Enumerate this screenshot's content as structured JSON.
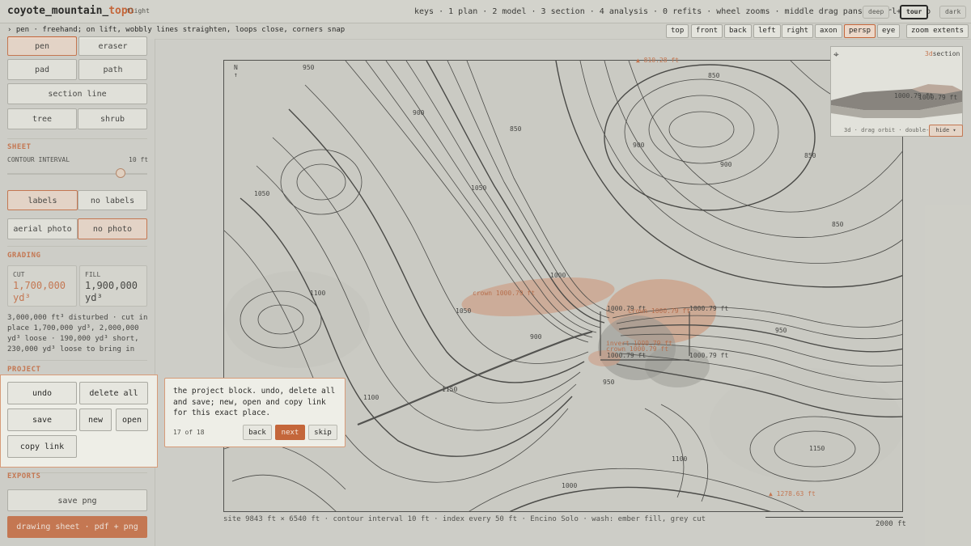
{
  "app": {
    "title_main": "coyote_mountain_",
    "title_accent": "topo",
    "mode": "flight",
    "keys_hint": "keys · 1 plan · 2 model · 3 section · 4 analysis · 0 refits · wheel zooms · middle drag pans · ctrl+z undo",
    "theme_buttons": [
      "deep",
      "tour",
      "dark"
    ]
  },
  "hintbar": {
    "text": "› pen · freehand; on lift, wobbly lines straighten, loops close, corners snap",
    "views": [
      "top",
      "front",
      "back",
      "left",
      "right",
      "axon",
      "persp",
      "eye"
    ],
    "active_view": "persp",
    "zoom_extents": "zoom extents"
  },
  "sidebar": {
    "tools": [
      "pen",
      "eraser",
      "pad",
      "path",
      "section line",
      "tree",
      "shrub"
    ],
    "sheet_title": "SHEET",
    "contour_interval_label": "CONTOUR INTERVAL",
    "contour_interval_value": "10 ft",
    "contour_interval_slider": 0.8,
    "labels_toggle": [
      "labels",
      "no labels"
    ],
    "photo_toggle": [
      "aerial photo",
      "no photo"
    ],
    "grading_title": "GRADING",
    "cut_label": "CUT",
    "cut_value": "1,700,000",
    "cut_unit": "yd³",
    "fill_label": "FILL",
    "fill_value": "1,900,000",
    "fill_unit": "yd³",
    "summary": "3,000,000 ft³ disturbed · cut in place 1,700,000 yd³, 2,000,000 yd³ loose · 190,000 yd³ short, 230,000 yd³ loose to bring in",
    "project_title": "PROJECT",
    "project_buttons": {
      "undo": "undo",
      "delete_all": "delete all",
      "save": "save",
      "new": "new",
      "open": "open",
      "copy_link": "copy link"
    },
    "exports_title": "EXPORTS",
    "save_png": "save png",
    "drawing_sheet": "drawing sheet · pdf + png"
  },
  "map": {
    "north": "N",
    "top_elev": "▲ 810.28 ft",
    "bottom_elev": "▲ 1278.63 ft",
    "contour_labels": [
      "950",
      "850",
      "900",
      "850",
      "900",
      "1050",
      "1050",
      "850",
      "900",
      "850",
      "1100",
      "950",
      "1000",
      "1050",
      "900",
      "1100",
      "1150",
      "950",
      "1100",
      "1150",
      "1000"
    ],
    "grading_labels": [
      "crown 1000.79 ft",
      "1000.79 ft",
      "crown 1000.79 ft",
      "1000.79 ft",
      "invert 1000.79 ft",
      "crown 1000.79 ft",
      "1000.79 ft",
      "1000.79 ft"
    ],
    "footer": "site 9843 ft × 6540 ft · contour interval 10 ft · index every 50 ft · Encino Solo · wash: ember fill, grey cut",
    "scale_label": "2000 ft"
  },
  "inset": {
    "title_accent": "3d",
    "title": "section",
    "label1": "1000.79 ft",
    "label2": "1000.79 ft",
    "hint": "3d · drag orbit · double-",
    "hide_button": "hide ▾"
  },
  "tour": {
    "text": "the project block. undo, delete all and save; new, open and copy link for this exact place.",
    "progress": "17 of 18",
    "back": "back",
    "next": "next",
    "skip": "skip"
  },
  "colors": {
    "accent": "#c4663a",
    "background": "#cfcfc8",
    "panel": "#eeeee7"
  }
}
